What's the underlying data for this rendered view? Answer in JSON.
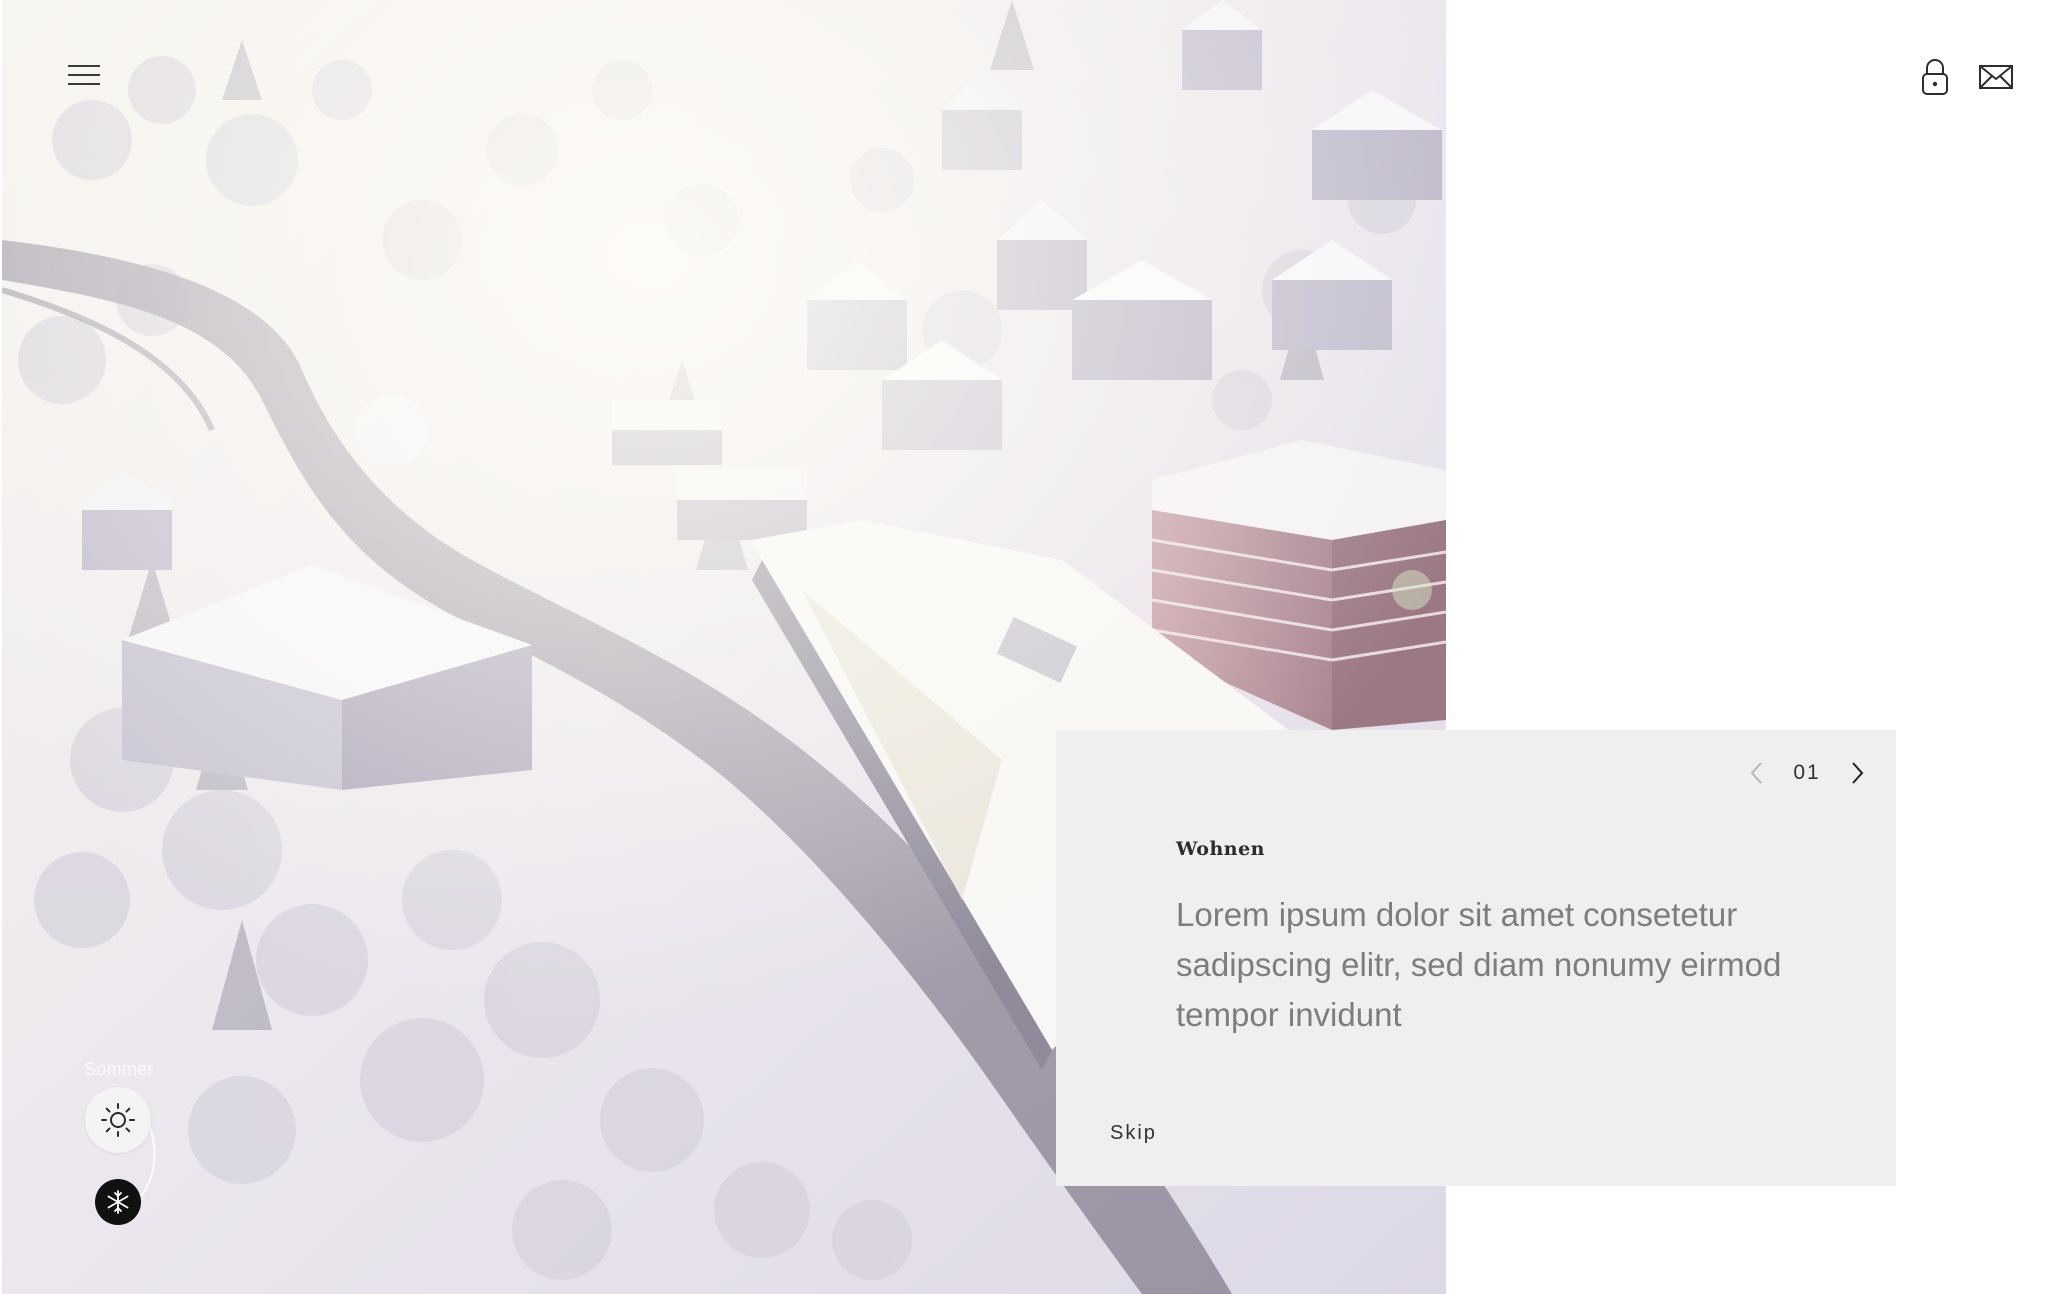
{
  "header": {
    "menu_icon": "hamburger-menu-icon",
    "lock_icon": "lock-icon",
    "mail_icon": "mail-icon"
  },
  "hero": {
    "image": "aerial-winter-architecture-render"
  },
  "season": {
    "label": "Sommer",
    "summer_icon": "sun-icon",
    "winter_icon": "snowflake-icon"
  },
  "card": {
    "page_number": "01",
    "prev_icon": "chevron-left-icon",
    "next_icon": "chevron-right-icon",
    "title": "Wohnen",
    "body": "Lorem ipsum dolor sit amet consetetur sadipscing elitr, sed diam nonumy eirmod tempor invidunt",
    "skip_label": "Skip"
  },
  "colors": {
    "card_background": "#efefef",
    "body_text": "#7d7d7d",
    "dark_text": "#2b2b2b",
    "winter_button": "#111111"
  }
}
